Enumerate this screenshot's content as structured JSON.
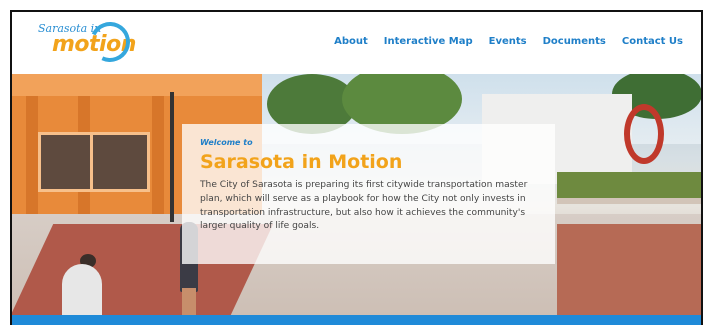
{
  "header": {
    "logo": {
      "script_text": "Sarasota in",
      "word_text": "motion"
    },
    "nav": [
      {
        "label": "About"
      },
      {
        "label": "Interactive Map"
      },
      {
        "label": "Events"
      },
      {
        "label": "Documents"
      },
      {
        "label": "Contact Us"
      }
    ]
  },
  "hero": {
    "eyebrow": "Welcome to",
    "title": "Sarasota in Motion",
    "body": "The City of Sarasota is preparing its first citywide transportation master plan, which will serve as a playbook for how the City not only invests in transportation infrastructure, but also how it achieves the community's larger quality of life goals."
  },
  "colors": {
    "brand_blue": "#1f7fc8",
    "brand_orange": "#f2a31b",
    "accent_bar": "#1f8ad8"
  }
}
